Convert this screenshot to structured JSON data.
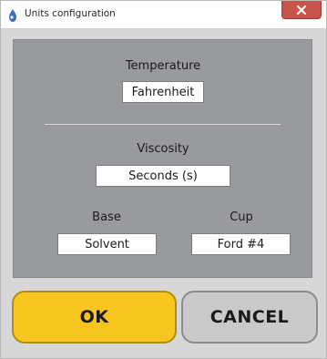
{
  "window": {
    "title": "Units configuration",
    "icons": {
      "app": "app-icon",
      "close": "close-icon"
    }
  },
  "temperature": {
    "label": "Temperature",
    "value": "Fahrenheit"
  },
  "viscosity": {
    "label": "Viscosity",
    "value": "Seconds (s)"
  },
  "base": {
    "label": "Base",
    "value": "Solvent"
  },
  "cup": {
    "label": "Cup",
    "value": "Ford #4"
  },
  "buttons": {
    "ok": "OK",
    "cancel": "CANCEL"
  },
  "colors": {
    "panel": "#999a9d",
    "ok_button": "#f6c51f",
    "cancel_button": "#c9c9c9",
    "close_button": "#c7544b"
  }
}
